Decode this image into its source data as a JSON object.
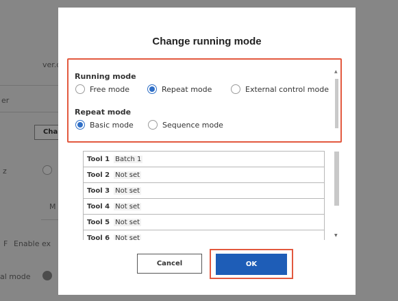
{
  "background": {
    "text_ver": "ver.q",
    "text_er": "er",
    "button_label": "Cha",
    "text_z": "z",
    "text_m": "M",
    "text_f": "F",
    "text_enable": "Enable ex",
    "text_mode": "al mode"
  },
  "dialog": {
    "title": "Change running mode",
    "running_mode": {
      "label": "Running mode",
      "options": [
        "Free mode",
        "Repeat mode",
        "External control mode"
      ],
      "selected": "Repeat mode"
    },
    "repeat_mode": {
      "label": "Repeat mode",
      "options": [
        "Basic mode",
        "Sequence mode"
      ],
      "selected": "Basic mode"
    },
    "tools": [
      {
        "name": "Tool 1",
        "value": "Batch 1"
      },
      {
        "name": "Tool 2",
        "value": "Not set"
      },
      {
        "name": "Tool 3",
        "value": "Not set"
      },
      {
        "name": "Tool 4",
        "value": "Not set"
      },
      {
        "name": "Tool 5",
        "value": "Not set"
      },
      {
        "name": "Tool 6",
        "value": "Not set"
      }
    ],
    "cancel_label": "Cancel",
    "ok_label": "OK"
  },
  "colors": {
    "highlight": "#e2583e",
    "primary": "#1e5db7",
    "radio_selected": "#2f6fc7"
  }
}
